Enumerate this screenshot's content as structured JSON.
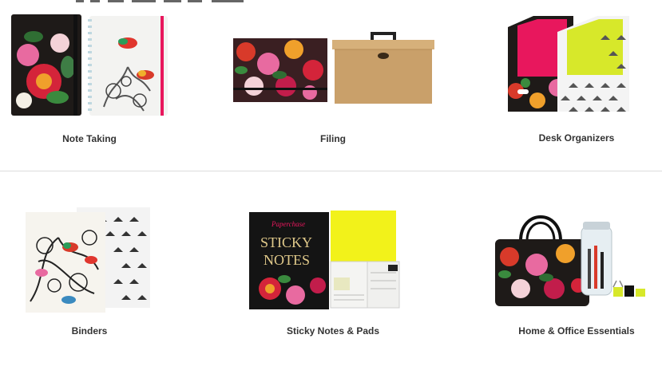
{
  "categories": [
    {
      "id": "note-taking",
      "label": "Note Taking"
    },
    {
      "id": "filing",
      "label": "Filing"
    },
    {
      "id": "desk-organizers",
      "label": "Desk Organizers"
    },
    {
      "id": "binders",
      "label": "Binders"
    },
    {
      "id": "sticky-notes",
      "label": "Sticky Notes & Pads",
      "cover_script": "Paperchase",
      "cover_title_line1": "STICKY",
      "cover_title_line2": "NOTES"
    },
    {
      "id": "home-office",
      "label": "Home & Office Essentials"
    }
  ],
  "colors": {
    "label": "#333333",
    "divider": "#dddddd",
    "floral_dark": "#1a1a1a",
    "kraft": "#c9a06a",
    "pink": "#e8175d",
    "lime": "#d7e82a",
    "yellow_note": "#f2f21a"
  }
}
